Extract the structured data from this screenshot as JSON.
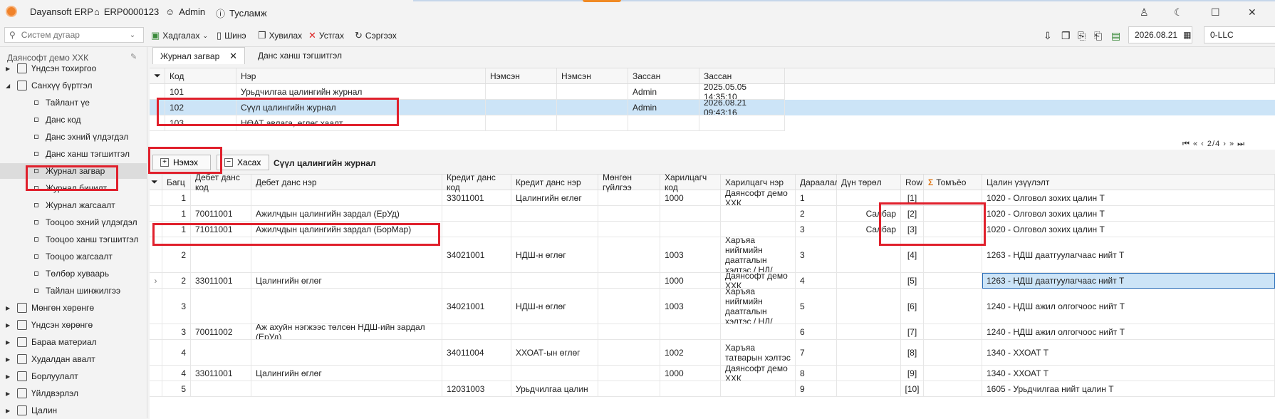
{
  "titlebar": {
    "app_name": "Dayansoft ERP",
    "code": "ERP0000123",
    "user": "Admin",
    "help": "Тусламж"
  },
  "toolbar": {
    "search_placeholder": "Систем дугаар",
    "save": "Хадгалах",
    "new": "Шинэ",
    "copy": "Хувилах",
    "cancel": "Устгах",
    "refresh": "Сэргээх",
    "date": "2026.08.21",
    "company_code": "0-LLC"
  },
  "sidebar": {
    "company": "Даянсофт демо ХХК",
    "items": [
      {
        "label": "Үндсэн тохиргоо",
        "level": 0
      },
      {
        "label": "Санхүү бүртгэл",
        "level": 0
      },
      {
        "label": "Тайлант үе",
        "level": 1
      },
      {
        "label": "Данс код",
        "level": 1
      },
      {
        "label": "Данс эхний үлдэгдэл",
        "level": 1
      },
      {
        "label": "Данс ханш тэгшитгэл",
        "level": 1
      },
      {
        "label": "Журнал загвар",
        "level": 1
      },
      {
        "label": "Журнал бичилт",
        "level": 1
      },
      {
        "label": "Журнал жагсаалт",
        "level": 1
      },
      {
        "label": "Тооцоо эхний үлдэгдэл",
        "level": 1
      },
      {
        "label": "Тооцоо ханш тэгшитгэл",
        "level": 1
      },
      {
        "label": "Тооцоо жагсаалт",
        "level": 1
      },
      {
        "label": "Төлбөр хуваарь",
        "level": 1
      },
      {
        "label": "Тайлан шинжилгээ",
        "level": 1
      },
      {
        "label": "Мөнгөн хөрөнгө",
        "level": 0
      },
      {
        "label": "Үндсэн хөрөнгө",
        "level": 0
      },
      {
        "label": "Бараа материал",
        "level": 0
      },
      {
        "label": "Худалдан авалт",
        "level": 0
      },
      {
        "label": "Борлуулалт",
        "level": 0
      },
      {
        "label": "Үйлдвэрлэл",
        "level": 0
      },
      {
        "label": "Цалин",
        "level": 0
      }
    ]
  },
  "tabs": [
    {
      "label": "Журнал загвар"
    },
    {
      "label": "Данс ханш тэгшитгэл"
    }
  ],
  "grid1": {
    "headers": [
      "Код",
      "Нэр",
      "Нэмсэн",
      "Нэмсэн",
      "Зассан",
      "Зассан"
    ],
    "rows": [
      [
        "101",
        "Урьдчилгаа цалингийн журнал",
        "",
        "",
        "Admin",
        "2025.05.05 14:35:10"
      ],
      [
        "102",
        "Сүүл цалингийн журнал",
        "",
        "",
        "Admin",
        "2026.08.21 09:43:16"
      ],
      [
        "103",
        "НӨАТ авлага, өглөг хаалт",
        "",
        "",
        "",
        ""
      ]
    ],
    "pager": "2/4"
  },
  "gridbar": {
    "add": "Нэмэх",
    "remove": "Хасах",
    "title": "Сүүл цалингийн журнал"
  },
  "grid2": {
    "headers": [
      "Багц",
      "Дебет данс код",
      "Дебет данс нэр",
      "Кредит данс код",
      "Кредит данс нэр",
      "Мөнгөн гүйлгээ",
      "Харилцагч код",
      "Харилцагч нэр",
      "Дараалал",
      "Дүн төрөл",
      "Row",
      "Томъёо",
      "Цалин үзүүлэлт"
    ],
    "rows": [
      [
        "1",
        "",
        "",
        "33011001",
        "Цалингийн өглөг",
        "",
        "1000",
        "Даянсофт демо ХХК",
        "1",
        "",
        "[1]",
        "",
        "1020 - Олговол зохих цалин Т"
      ],
      [
        "1",
        "70011001",
        "Ажилчдын цалингийн зардал (ЕрУд)",
        "",
        "",
        "",
        "",
        "",
        "2",
        "Салбар",
        "[2]",
        "",
        "1020 - Олговол зохих цалин Т"
      ],
      [
        "1",
        "71011001",
        "Ажилчдын цалингийн зардал (БорМар)",
        "",
        "",
        "",
        "",
        "",
        "3",
        "Салбар",
        "[3]",
        "",
        "1020 - Олговол зохих цалин Т"
      ],
      [
        "2",
        "",
        "",
        "34021001",
        "НДШ-н өглөг",
        "",
        "1003",
        "Харъяа нийгмийн даатгалын хэлтэс / НД/",
        "3",
        "",
        "[4]",
        "",
        "1263 - НДШ даатгуулагчаас нийт Т"
      ],
      [
        "2",
        "33011001",
        "Цалингийн өглөг",
        "",
        "",
        "",
        "1000",
        "Даянсофт демо ХХК",
        "4",
        "",
        "[5]",
        "",
        "1263 - НДШ даатгуулагчаас нийт Т"
      ],
      [
        "3",
        "",
        "",
        "34021001",
        "НДШ-н өглөг",
        "",
        "1003",
        "Харъяа нийгмийн даатгалын хэлтэс / НД/",
        "5",
        "",
        "[6]",
        "",
        "1240 - НДШ ажил олгогчоос нийт Т"
      ],
      [
        "3",
        "70011002",
        "Аж ахуйн нэгжээс төлсөн НДШ-ийн зардал (ЕрУд)",
        "",
        "",
        "",
        "",
        "",
        "6",
        "",
        "[7]",
        "",
        "1240 - НДШ ажил олгогчоос нийт Т"
      ],
      [
        "4",
        "",
        "",
        "34011004",
        "ХХОАТ-ын өглөг",
        "",
        "1002",
        "Харъяа татварын хэлтэс",
        "7",
        "",
        "[8]",
        "",
        "1340 - ХХОАТ Т"
      ],
      [
        "4",
        "33011001",
        "Цалингийн өглөг",
        "",
        "",
        "",
        "1000",
        "Даянсофт демо ХХК",
        "8",
        "",
        "[9]",
        "",
        "1340 - ХХОАТ Т"
      ],
      [
        "5",
        "",
        "",
        "12031003",
        "Урьдчилгаа цалин",
        "",
        "",
        "",
        "9",
        "",
        "[10]",
        "",
        "1605 - Урьдчилгаа нийт цалин Т"
      ]
    ]
  }
}
